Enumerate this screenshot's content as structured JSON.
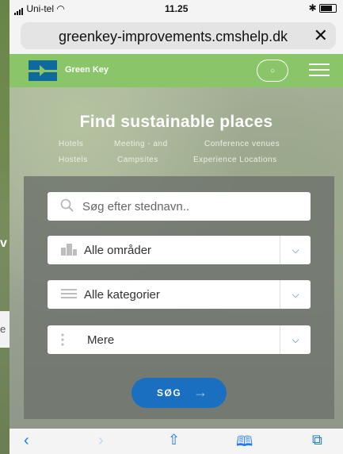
{
  "status": {
    "carrier": "Uni-tel",
    "time": "11.25"
  },
  "browser": {
    "url": "greenkey-improvements.cmshelp.dk",
    "close_label": "✕"
  },
  "site": {
    "brand": "Green Key",
    "menu_icon": "hamburger-icon",
    "search_icon": "search-icon"
  },
  "hero": {
    "title": "Find sustainable places",
    "categories_row1": [
      "Hotels",
      "Meeting - and",
      "Conference venues"
    ],
    "categories_row2": [
      "Hostels",
      "Campsites",
      "Experience Locations"
    ]
  },
  "form": {
    "search_placeholder": "Søg efter stednavn..",
    "area_select": "Alle områder",
    "category_select": "Alle kategorier",
    "more_select": "Mere",
    "submit_label": "SØG"
  },
  "background": {
    "partial_letter": "v",
    "partial_side_letter": "e"
  },
  "colors": {
    "nav_green": "#8bc56a",
    "button_blue": "#1a6fc0",
    "ios_blue": "#1e7af0"
  }
}
